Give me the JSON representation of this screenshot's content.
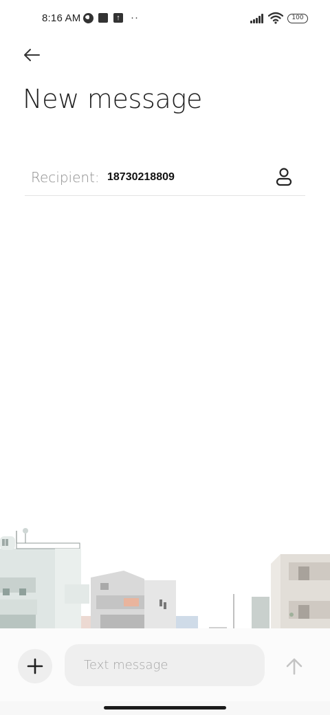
{
  "status_bar": {
    "time": "8:16 AM",
    "battery": "100",
    "icons": [
      "circle-app-icon",
      "square-app-icon",
      "upload-icon",
      "more-dots-icon",
      "signal-icon",
      "wifi-icon",
      "battery-icon"
    ]
  },
  "header": {
    "back_icon": "arrow-left-icon",
    "title": "New message"
  },
  "recipient": {
    "label": "Recipient:",
    "value": "18730218809",
    "contact_icon": "person-icon"
  },
  "compose": {
    "attach_icon": "plus-icon",
    "placeholder": "Text message",
    "value": "",
    "send_icon": "arrow-up-icon"
  },
  "colors": {
    "background": "#ffffff",
    "field": "#efefef",
    "label_gray": "#8e8e8e",
    "send_disabled": "#c4c4c4"
  }
}
